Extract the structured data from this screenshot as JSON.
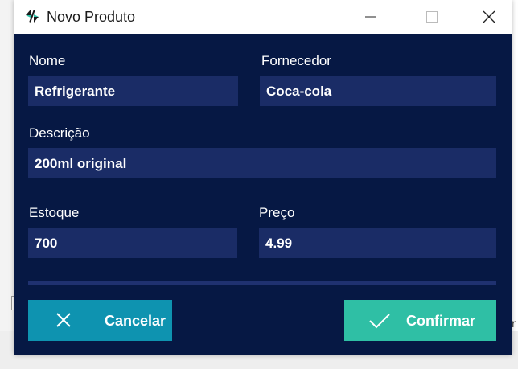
{
  "window": {
    "title": "Novo Produto",
    "app_icon": "swap-arrows-icon"
  },
  "titlebar_buttons": [
    "minimize-icon",
    "maximize-icon",
    "close-icon"
  ],
  "form": {
    "nome": {
      "label": "Nome",
      "value": "Refrigerante"
    },
    "fornecedor": {
      "label": "Fornecedor",
      "value": "Coca-cola"
    },
    "descricao": {
      "label": "Descrição",
      "value": "200ml original"
    },
    "estoque": {
      "label": "Estoque",
      "value": "700"
    },
    "preco": {
      "label": "Preço",
      "value": "4.99"
    }
  },
  "buttons": {
    "cancel": {
      "label": "Cancelar",
      "icon": "x-icon",
      "color": "#0e93b0"
    },
    "confirm": {
      "label": "Confirmar",
      "icon": "checkmark-icon",
      "color": "#2fbfa5"
    }
  },
  "background_text": "r",
  "colors": {
    "window_bg": "#061844",
    "field_bg": "#1a2c66",
    "text": "#ffffff"
  }
}
